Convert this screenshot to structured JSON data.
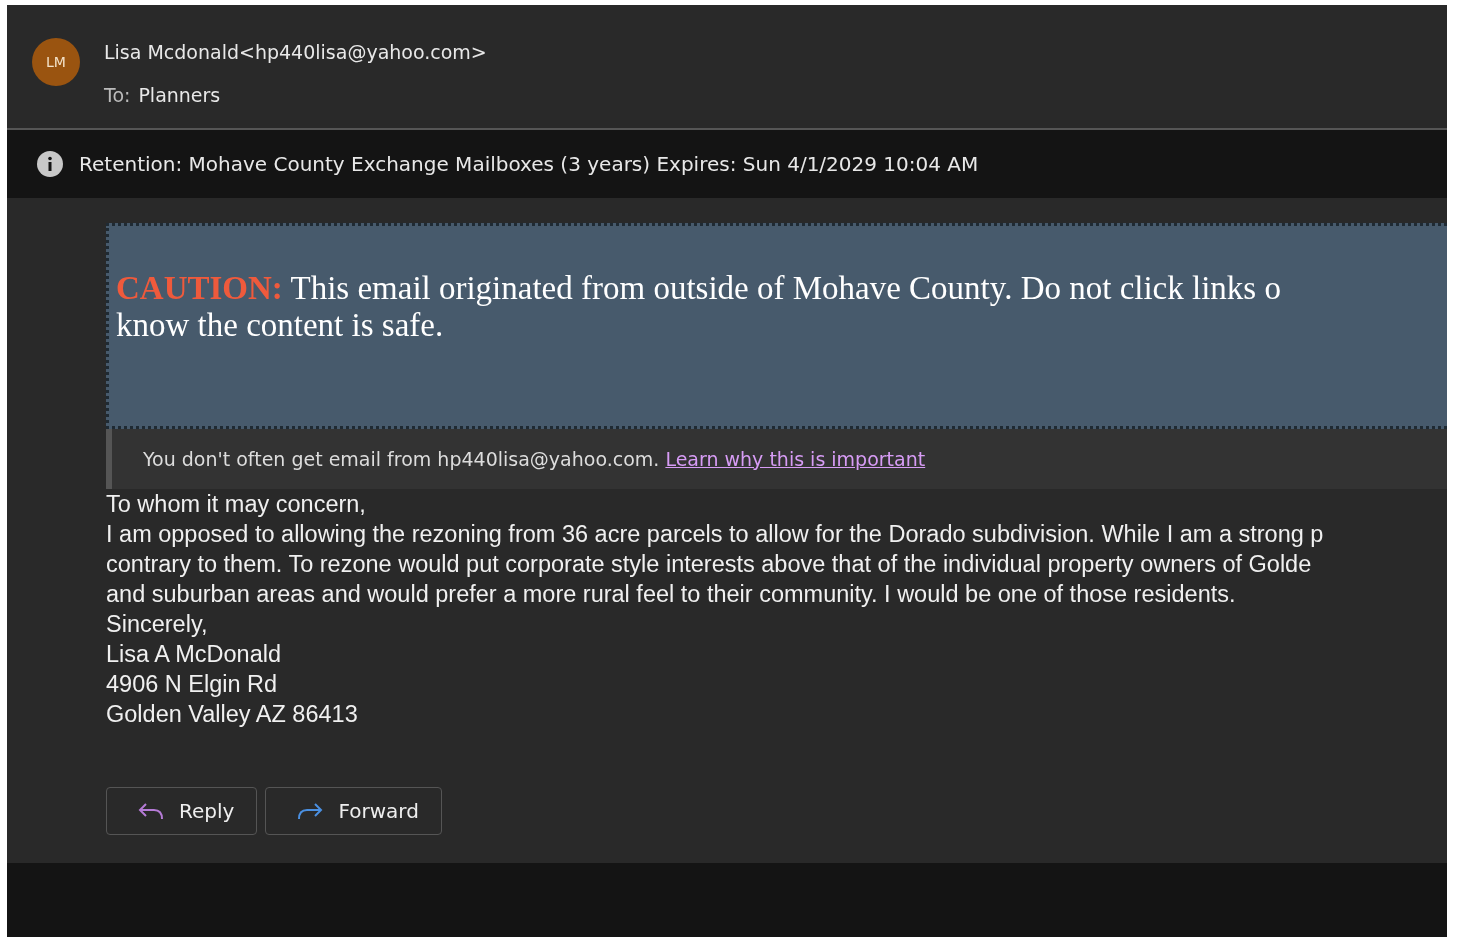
{
  "sender": {
    "initials": "LM",
    "name": "Lisa Mcdonald",
    "address": "<hp440lisa@yahoo.com>",
    "to_label": "To:",
    "to": "Planners"
  },
  "retention": {
    "text": "Retention: Mohave County Exchange Mailboxes (3 years) Expires: Sun 4/1/2029 10:04 AM"
  },
  "caution": {
    "label": "CAUTION:",
    "lines": [
      "This email originated from outside of Mohave County. Do not click links o",
      "know the content is safe."
    ]
  },
  "notice": {
    "text": "You don't often get email from hp440lisa@yahoo.com.",
    "link": "Learn why this is important"
  },
  "body_lines": [
    "To whom it may concern,",
    "I am opposed to allowing the rezoning from 36 acre parcels to allow for the Dorado subdivision. While I am a strong p",
    "contrary to them. To rezone would put corporate style interests above that of the individual property owners of Golde",
    "and suburban areas and would prefer a more rural feel to their community. I would be one of those residents.",
    "Sincerely,",
    "Lisa A McDonald",
    "4906 N Elgin Rd",
    "Golden Valley AZ 86413"
  ],
  "actions": [
    {
      "kind": "reply",
      "label": "Reply"
    },
    {
      "kind": "forward",
      "label": "Forward"
    }
  ]
}
